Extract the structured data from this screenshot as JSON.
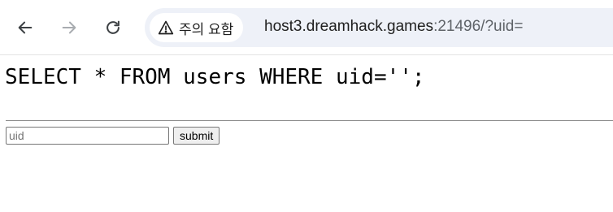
{
  "browser": {
    "security_chip": {
      "icon": "warning-triangle-icon",
      "label": "주의 요함"
    },
    "url": {
      "host": "host3.dreamhack.games",
      "path": ":21496/?uid="
    },
    "icons": {
      "back": "back-arrow-icon",
      "forward": "forward-arrow-icon",
      "reload": "reload-icon"
    }
  },
  "page": {
    "query": "SELECT * FROM users WHERE uid='';",
    "form": {
      "uid_placeholder": "uid",
      "uid_value": "",
      "submit_label": "submit"
    }
  }
}
